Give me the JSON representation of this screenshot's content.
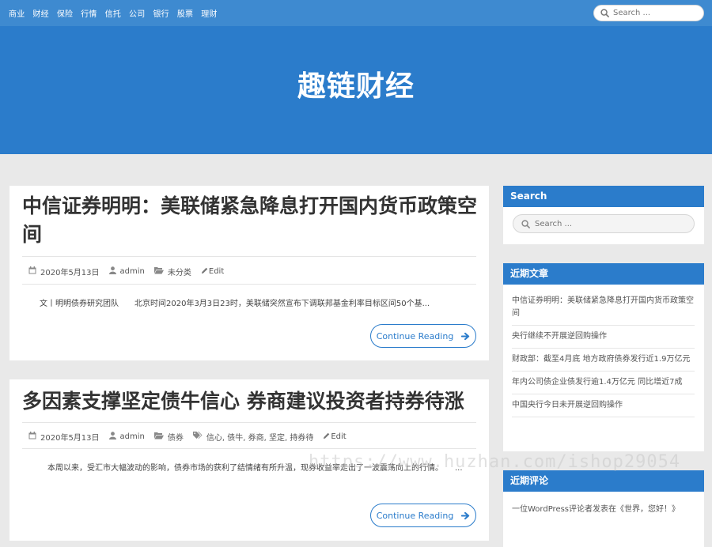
{
  "nav": {
    "items": [
      "商业",
      "财经",
      "保险",
      "行情",
      "信托",
      "公司",
      "银行",
      "股票",
      "理财"
    ]
  },
  "top_search": {
    "placeholder": "Search ..."
  },
  "site": {
    "title": "趣链财经"
  },
  "posts": [
    {
      "title": "中信证券明明：美联储紧急降息打开国内货币政策空间",
      "date": "2020年5月13日",
      "author": "admin",
      "category": "未分类",
      "tags": "",
      "edit": "Edit",
      "excerpt": "文丨明明债券研究团队　　北京时间2020年3月3日23时，美联储突然宣布下调联邦基金利率目标区间50个基...",
      "read_more": "Continue Reading"
    },
    {
      "title": "多因素支撑坚定债牛信心 券商建议投资者持券待涨",
      "date": "2020年5月13日",
      "author": "admin",
      "category": "债券",
      "tags": "信心, 债牛, 券商, 坚定, 持券待",
      "edit": "Edit",
      "excerpt": "本周以来，受汇市大幅波动的影响，债券市场的获利了结情绪有所升温，现券收益率走出了一波震荡向上的行情。　　...",
      "read_more": "Continue Reading"
    }
  ],
  "sidebar": {
    "search": {
      "title": "Search",
      "placeholder": "Search ..."
    },
    "recent": {
      "title": "近期文章",
      "items": [
        "中信证券明明：美联储紧急降息打开国内货币政策空间",
        "央行继续不开展逆回购操作",
        "财政部：截至4月底 地方政府债券发行近1.9万亿元",
        "年内公司债企业债发行逾1.4万亿元 同比增近7成",
        "中国央行今日未开展逆回购操作"
      ]
    },
    "comments": {
      "title": "近期评论",
      "text": "一位WordPress评论者发表在《世界，您好！》"
    }
  },
  "watermark": "https://www.huzhan.com/ishop29054",
  "colors": {
    "topbar": "#3e8ad0",
    "hero": "#2b7ccb",
    "accent": "#2b7ccb",
    "background": "#e9e9e9"
  }
}
